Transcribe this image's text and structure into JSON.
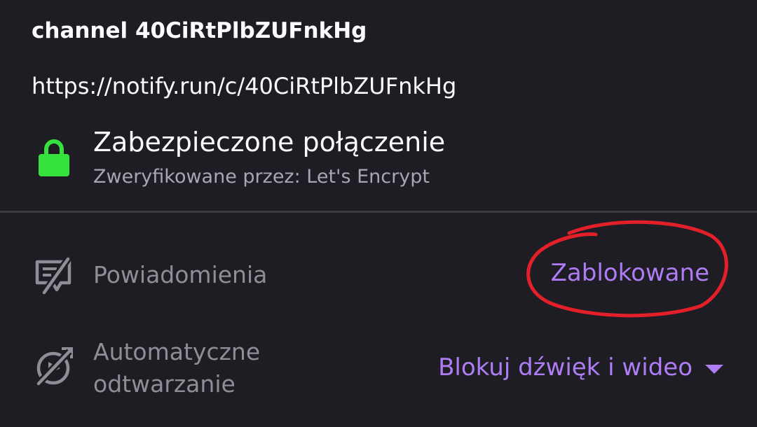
{
  "site": {
    "title": "channel 40CiRtPlbZUFnkHg",
    "url": "https://notify.run/c/40CiRtPlbZUFnkHg"
  },
  "security": {
    "title": "Zabezpieczone połączenie",
    "subtitle": "Zweryfikowane przez: Let's Encrypt",
    "icon": "lock-icon",
    "icon_color": "#35e13c"
  },
  "permissions": {
    "notifications": {
      "label": "Powiadomienia",
      "value": "Zablokowane",
      "icon": "notification-blocked-icon"
    },
    "autoplay": {
      "label": "Automatyczne odtwarzanie",
      "value": "Blokuj dźwięk i wideo",
      "icon": "autoplay-blocked-icon"
    }
  },
  "colors": {
    "background": "#1e1d23",
    "accent": "#ae7cf4",
    "annotation": "#e3202a"
  }
}
